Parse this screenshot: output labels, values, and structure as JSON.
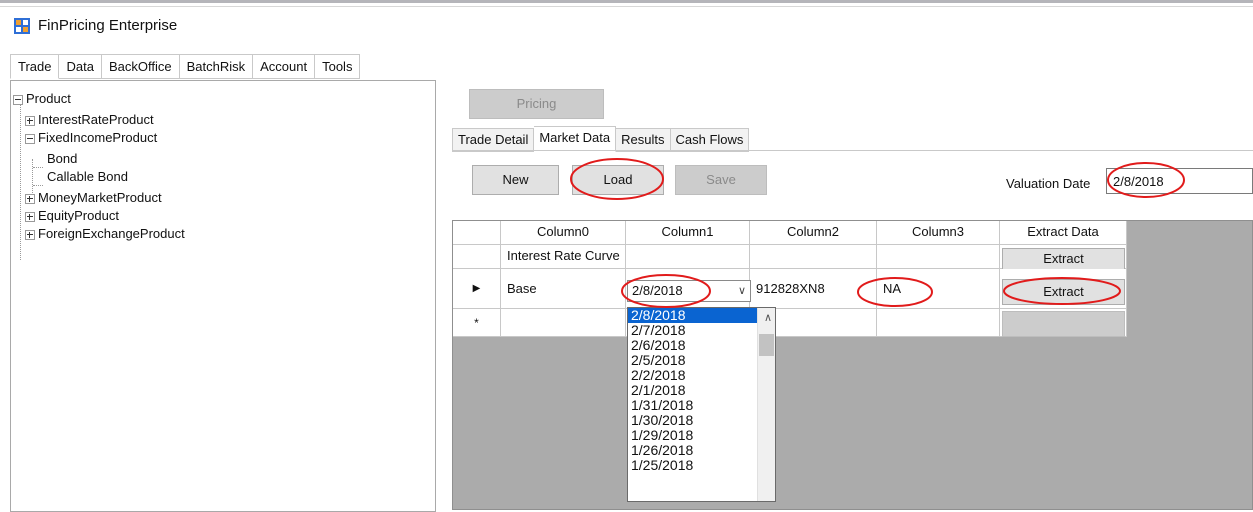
{
  "window": {
    "title": "FinPricing Enterprise"
  },
  "menu": {
    "items": [
      "Trade",
      "Data",
      "BackOffice",
      "BatchRisk",
      "Account",
      "Tools"
    ]
  },
  "tree": {
    "root": "Product",
    "interest_rate": "InterestRateProduct",
    "fixed_income": "FixedIncomeProduct",
    "bond": "Bond",
    "callable_bond": "Callable Bond",
    "money_market": "MoneyMarketProduct",
    "equity": "EquityProduct",
    "fx": "ForeignExchangeProduct"
  },
  "toolbar": {
    "pricing_label": "Pricing",
    "new_label": "New",
    "load_label": "Load",
    "save_label": "Save"
  },
  "tabs": [
    "Trade Detail",
    "Market Data",
    "Results",
    "Cash Flows"
  ],
  "valuation": {
    "label": "Valuation Date",
    "value": "2/8/2018"
  },
  "grid": {
    "headers": [
      "Column0",
      "Column1",
      "Column2",
      "Column3",
      "Extract Data"
    ],
    "row1": {
      "c0": "Interest Rate Curve",
      "c1": "",
      "c2": "",
      "c3": "",
      "button": "Extract"
    },
    "row2": {
      "c0": "Base",
      "c1": "2/8/2018",
      "c2": "912828XN8",
      "c3": "NA",
      "button": "Extract"
    },
    "new_row_marker": "*",
    "current_row_marker": "▶"
  },
  "dropdown": {
    "options": [
      "2/8/2018",
      "2/7/2018",
      "2/6/2018",
      "2/5/2018",
      "2/2/2018",
      "2/1/2018",
      "1/31/2018",
      "1/30/2018",
      "1/29/2018",
      "1/26/2018",
      "1/25/2018"
    ],
    "selected_index": 0
  },
  "icons": {
    "app": "app-window-icon",
    "combo_arrow": "chevron-down-icon",
    "scroll_up": "chevron-up-icon"
  },
  "colors": {
    "selection": "#0a64d1",
    "annotation": "#e11b1b",
    "grid_bg": "#ababab"
  }
}
